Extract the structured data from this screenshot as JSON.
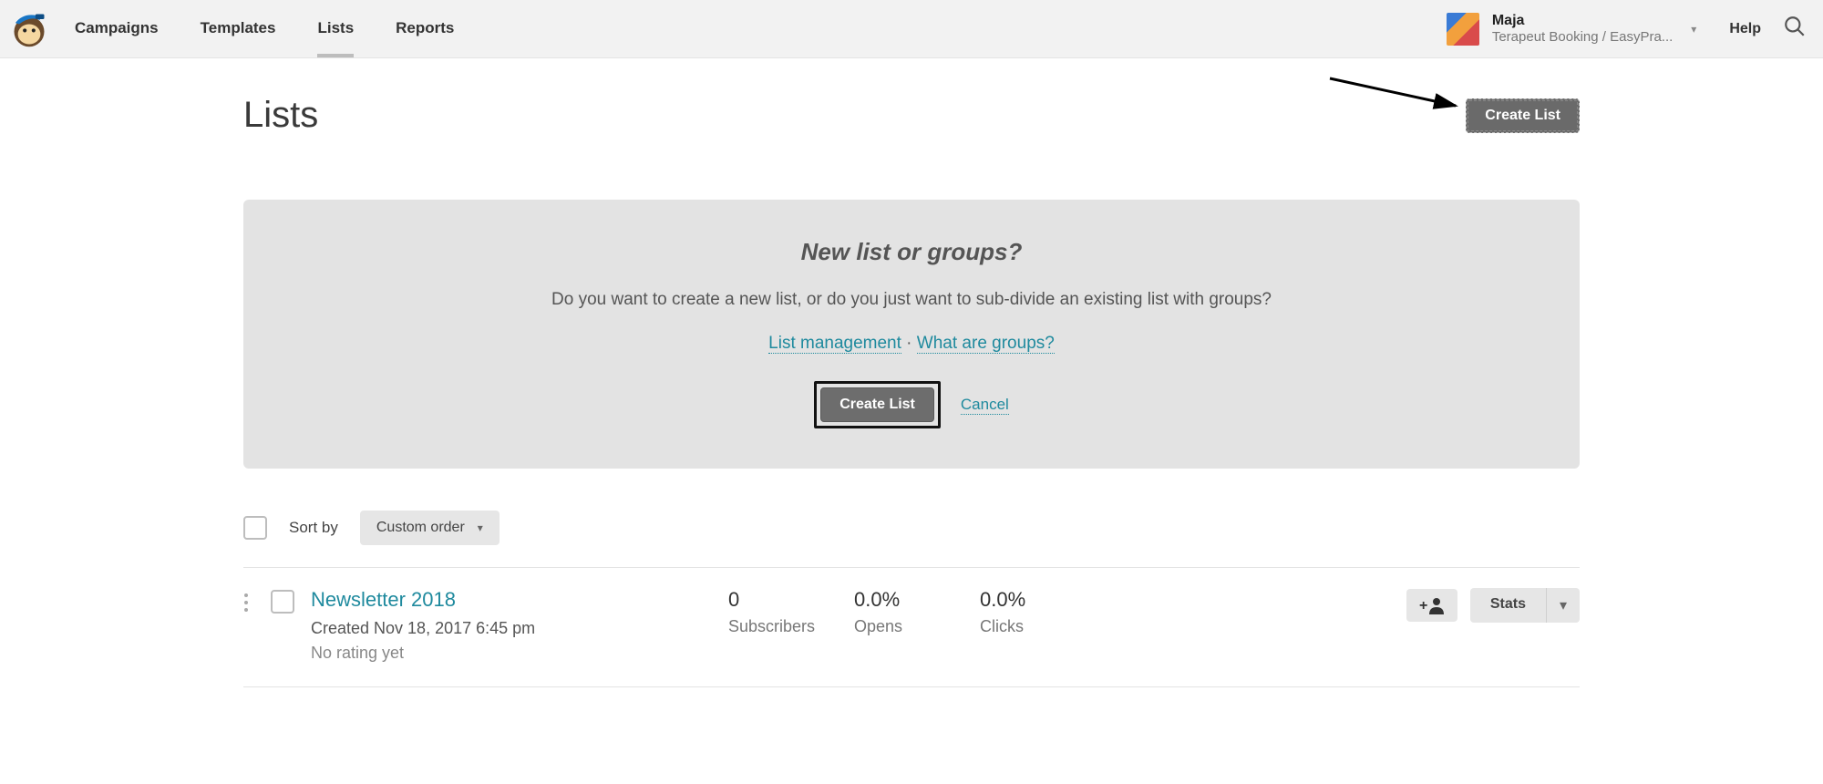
{
  "nav": {
    "items": [
      {
        "label": "Campaigns"
      },
      {
        "label": "Templates"
      },
      {
        "label": "Lists"
      },
      {
        "label": "Reports"
      }
    ],
    "active_index": 2,
    "help_label": "Help"
  },
  "account": {
    "name": "Maja",
    "sub": "Terapeut Booking / EasyPra..."
  },
  "page": {
    "title": "Lists",
    "create_button": "Create List"
  },
  "panel": {
    "heading": "New list or groups?",
    "body": "Do you want to create a new list, or do you just want to sub-divide an existing list with groups?",
    "link1": "List management",
    "separator": " · ",
    "link2": "What are groups?",
    "primary_button": "Create List",
    "cancel": "Cancel"
  },
  "sort": {
    "label": "Sort by",
    "selected": "Custom order"
  },
  "lists": [
    {
      "title": "Newsletter 2018",
      "created": "Created Nov 18, 2017 6:45 pm",
      "rating": "No rating yet",
      "subscribers_value": "0",
      "subscribers_label": "Subscribers",
      "opens_value": "0.0%",
      "opens_label": "Opens",
      "clicks_value": "0.0%",
      "clicks_label": "Clicks",
      "stats_label": "Stats"
    }
  ]
}
